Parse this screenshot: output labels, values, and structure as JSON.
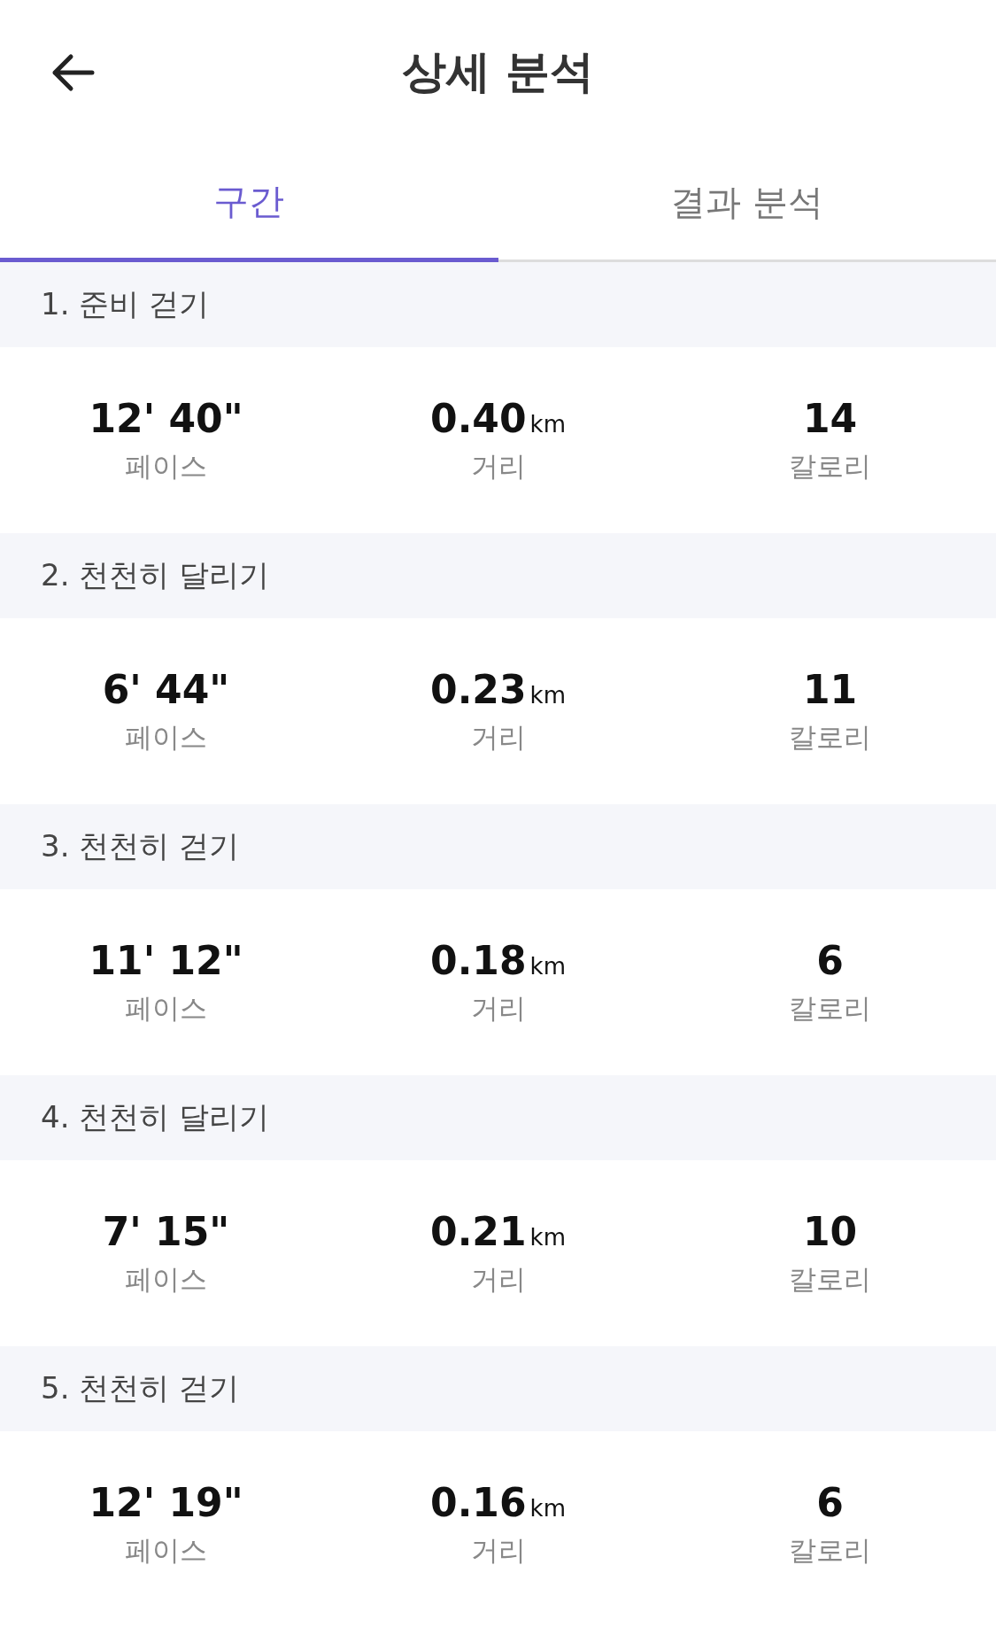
{
  "header": {
    "title": "상세 분석"
  },
  "tabs": [
    {
      "label": "구간",
      "selected": true
    },
    {
      "label": "결과 분석",
      "selected": false
    }
  ],
  "sections": [
    {
      "title": "1. 준비 걷기",
      "stats": [
        {
          "value": "12' 40\"",
          "label": "페이스"
        },
        {
          "value": "0.40",
          "unit": "km",
          "label": "거리"
        },
        {
          "value": "14",
          "label": "칼로리"
        }
      ]
    },
    {
      "title": "2. 천천히 달리기",
      "stats": [
        {
          "value": "6' 44\"",
          "label": "페이스"
        },
        {
          "value": "0.23",
          "unit": "km",
          "label": "거리"
        },
        {
          "value": "11",
          "label": "칼로리"
        }
      ]
    },
    {
      "title": "3. 천천히 걷기",
      "stats": [
        {
          "value": "11' 12\"",
          "label": "페이스"
        },
        {
          "value": "0.18",
          "unit": "km",
          "label": "거리"
        },
        {
          "value": "6",
          "label": "칼로리"
        }
      ]
    },
    {
      "title": "4. 천천히 달리기",
      "stats": [
        {
          "value": "7' 15\"",
          "label": "페이스"
        },
        {
          "value": "0.21",
          "unit": "km",
          "label": "거리"
        },
        {
          "value": "10",
          "label": "칼로리"
        }
      ]
    },
    {
      "title": "5. 천천히 걷기",
      "stats": [
        {
          "value": "12' 19\"",
          "label": "페이스"
        },
        {
          "value": "0.16",
          "unit": "km",
          "label": "거리"
        },
        {
          "value": "6",
          "label": "칼로리"
        }
      ]
    }
  ]
}
